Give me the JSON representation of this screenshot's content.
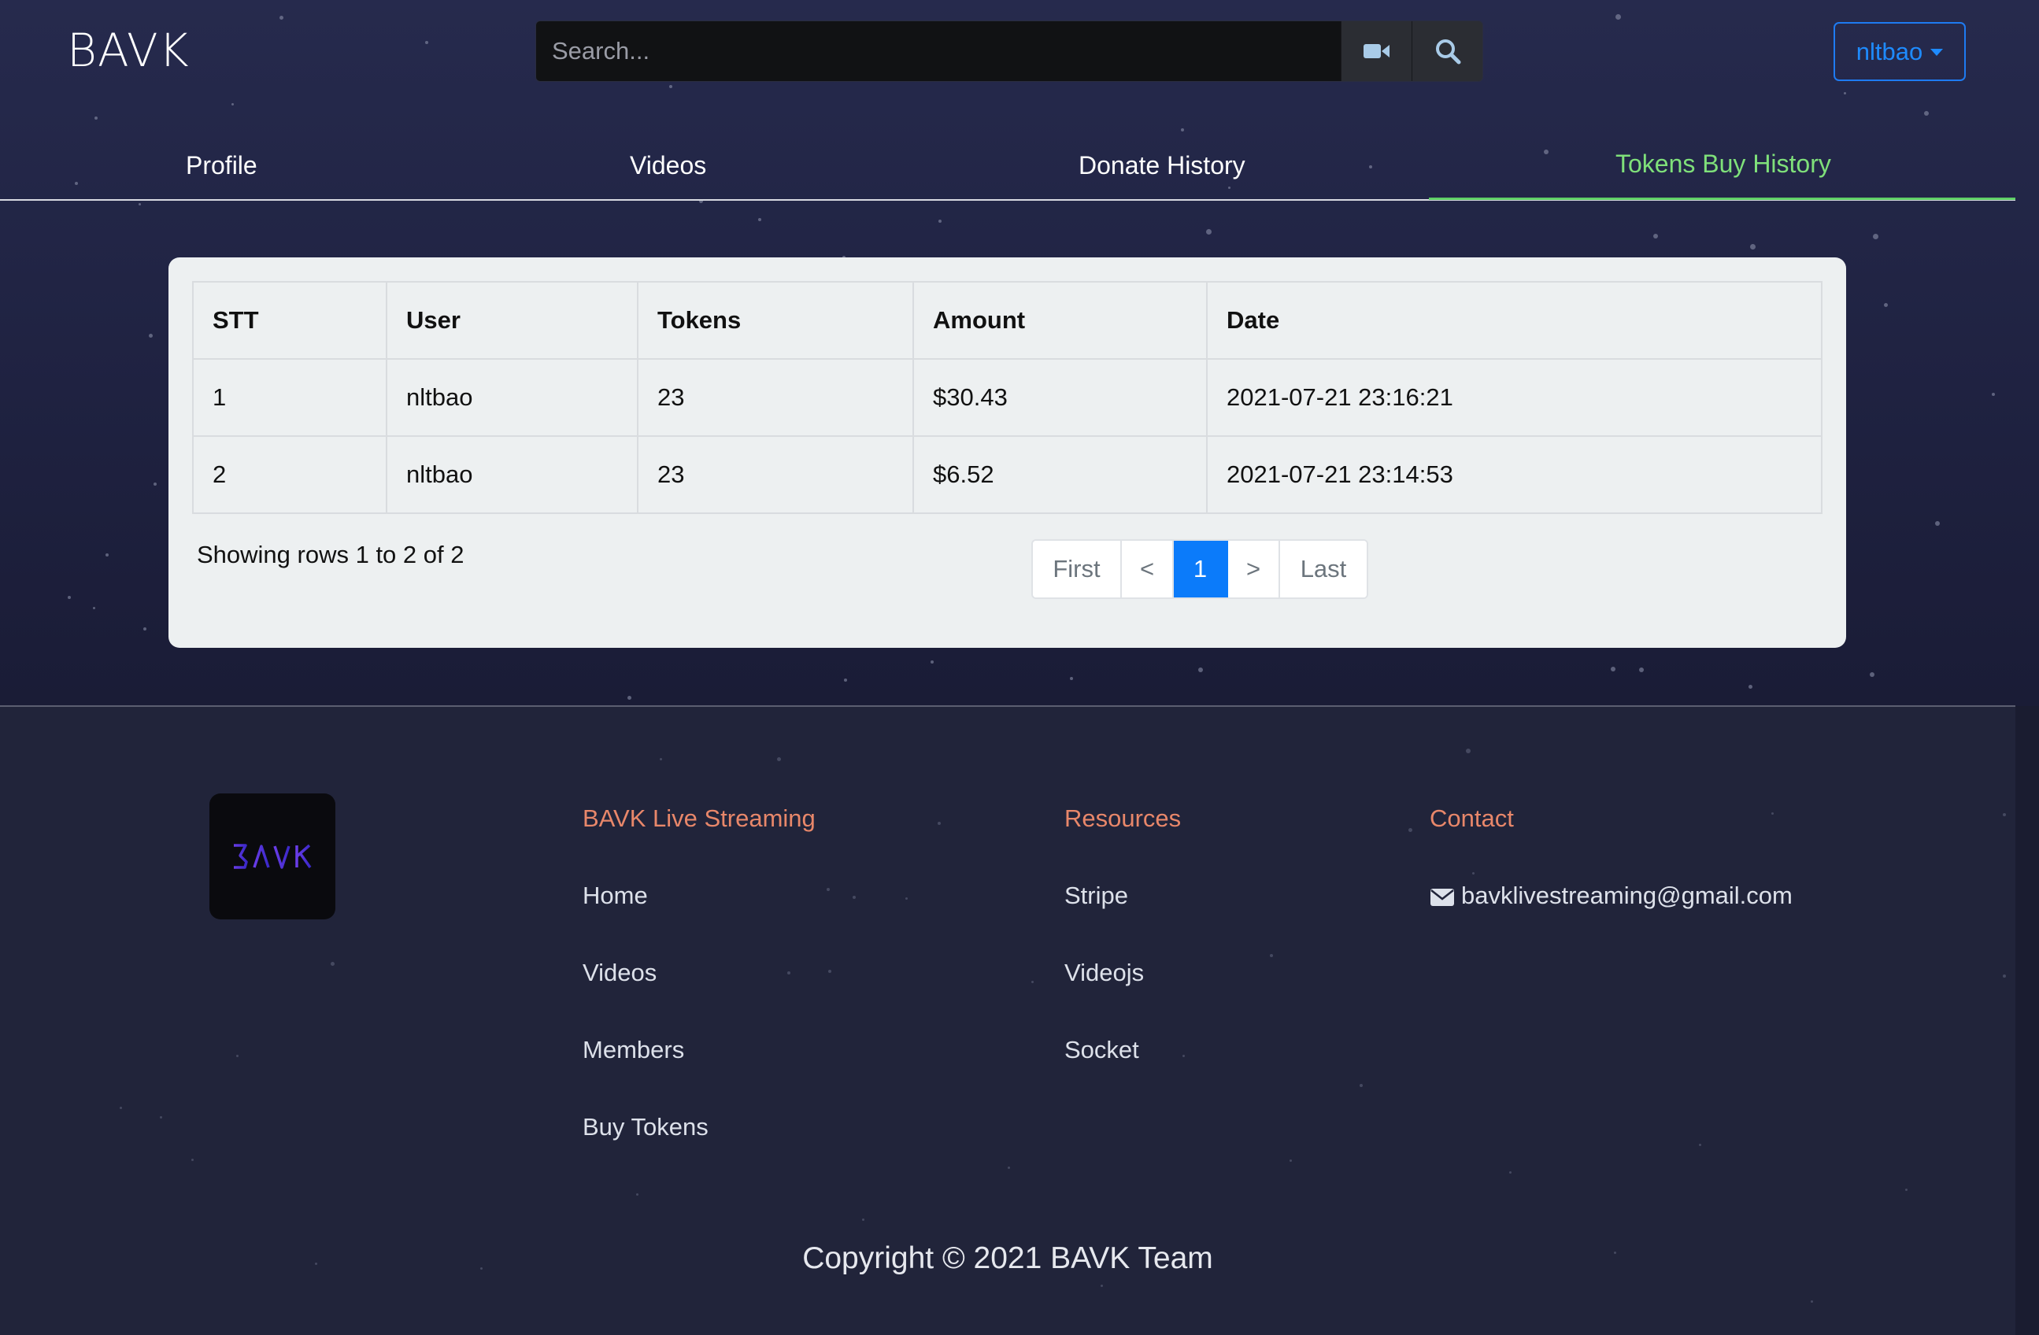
{
  "header": {
    "logo": "BAVK",
    "search_placeholder": "Search...",
    "video_icon": "video-camera-icon",
    "search_icon": "search-icon",
    "user_menu_label": "nltbao"
  },
  "tabs": [
    {
      "label": "Profile",
      "active": false
    },
    {
      "label": "Videos",
      "active": false
    },
    {
      "label": "Donate History",
      "active": false
    },
    {
      "label": "Tokens Buy History",
      "active": true
    }
  ],
  "table": {
    "columns": [
      "STT",
      "User",
      "Tokens",
      "Amount",
      "Date"
    ],
    "rows": [
      [
        "1",
        "nltbao",
        "23",
        "$30.43",
        "2021-07-21 23:16:21"
      ],
      [
        "2",
        "nltbao",
        "23",
        "$6.52",
        "2021-07-21 23:14:53"
      ]
    ],
    "showing_text": "Showing rows 1 to 2 of 2"
  },
  "pagination": {
    "first": "First",
    "prev": "<",
    "current": "1",
    "next": ">",
    "last": "Last"
  },
  "footer": {
    "logo_text": "BAVK",
    "col1": {
      "heading": "BAVK Live Streaming",
      "links": [
        "Home",
        "Videos",
        "Members",
        "Buy Tokens"
      ]
    },
    "col2": {
      "heading": "Resources",
      "links": [
        "Stripe",
        "Videojs",
        "Socket"
      ]
    },
    "col3": {
      "heading": "Contact",
      "email": "bavklivestreaming@gmail.com",
      "email_icon": "envelope-icon"
    },
    "copyright": "Copyright © 2021 BAVK Team"
  },
  "colors": {
    "accent_active_tab": "#7fe07a",
    "pagination_active": "#0b7bfa",
    "footer_heading": "#e8876a",
    "user_button": "#1e8bff"
  }
}
